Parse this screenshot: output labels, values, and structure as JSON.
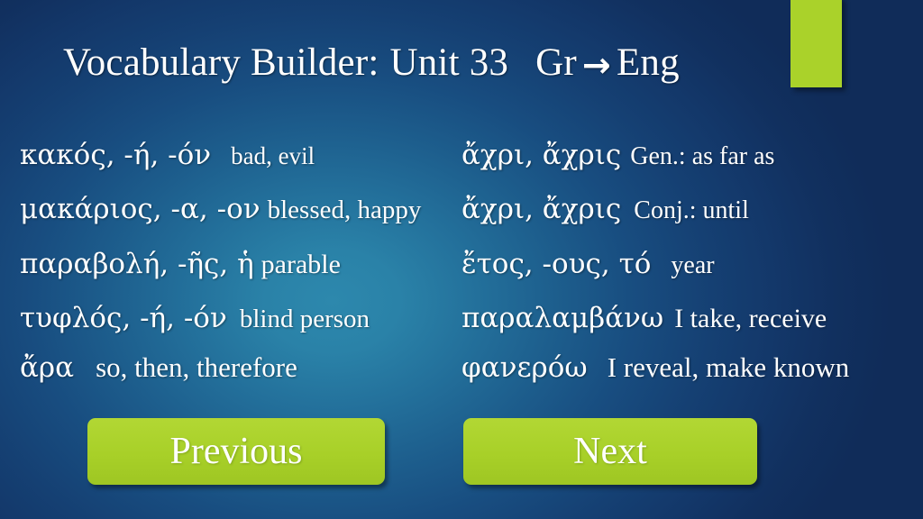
{
  "slide": {
    "title": {
      "main": "Vocabulary Builder:",
      "unit": "Unit 33",
      "direction_from": "Gr",
      "arrow_icon": "right-arrow-icon",
      "arrow_glyph": "→",
      "direction_to": "Eng"
    },
    "accent_color": "#aad22a",
    "background_colors": {
      "center": "#2d88ad",
      "edge": "#102c59"
    }
  },
  "vocabulary": {
    "left_column": [
      {
        "greek": "κακός,  -ή,  -όν",
        "gloss": "bad, evil",
        "gloss_size": 27,
        "gap": 22
      },
      {
        "greek": "μακάριος, -α, -ον",
        "gloss": "blessed, happy",
        "gloss_size": 29,
        "gap": 8
      },
      {
        "greek": "παραβολή,  -ῆς,  ἡ",
        "gloss": "parable",
        "gloss_size": 30,
        "gap": 8
      },
      {
        "greek": "τυφλός, -ή, -όν",
        "gloss": "blind person",
        "gloss_size": 29,
        "gap": 14
      },
      {
        "greek": "ἄρα",
        "gloss": "so, then, therefore",
        "gloss_size": 31,
        "gap": 24
      }
    ],
    "right_column": [
      {
        "greek": "ἄχρι, ἄχρις",
        "gloss": "Gen.: as far as",
        "gloss_size": 28,
        "gap": 10
      },
      {
        "greek": "ἄχρι, ἄχρις",
        "gloss": "Conj.: until",
        "gloss_size": 28,
        "gap": 14
      },
      {
        "greek": "ἔτος,  -ους,  τό",
        "gloss": "year",
        "gloss_size": 28,
        "gap": 22
      },
      {
        "greek": "παραλαμβάνω",
        "gloss": "I take, receive",
        "gloss_size": 30,
        "gap": 12
      },
      {
        "greek": "φανερόω",
        "gloss": "I reveal, make known",
        "gloss_size": 31,
        "gap": 22
      }
    ]
  },
  "buttons": {
    "previous_label": "Previous",
    "next_label": "Next"
  }
}
